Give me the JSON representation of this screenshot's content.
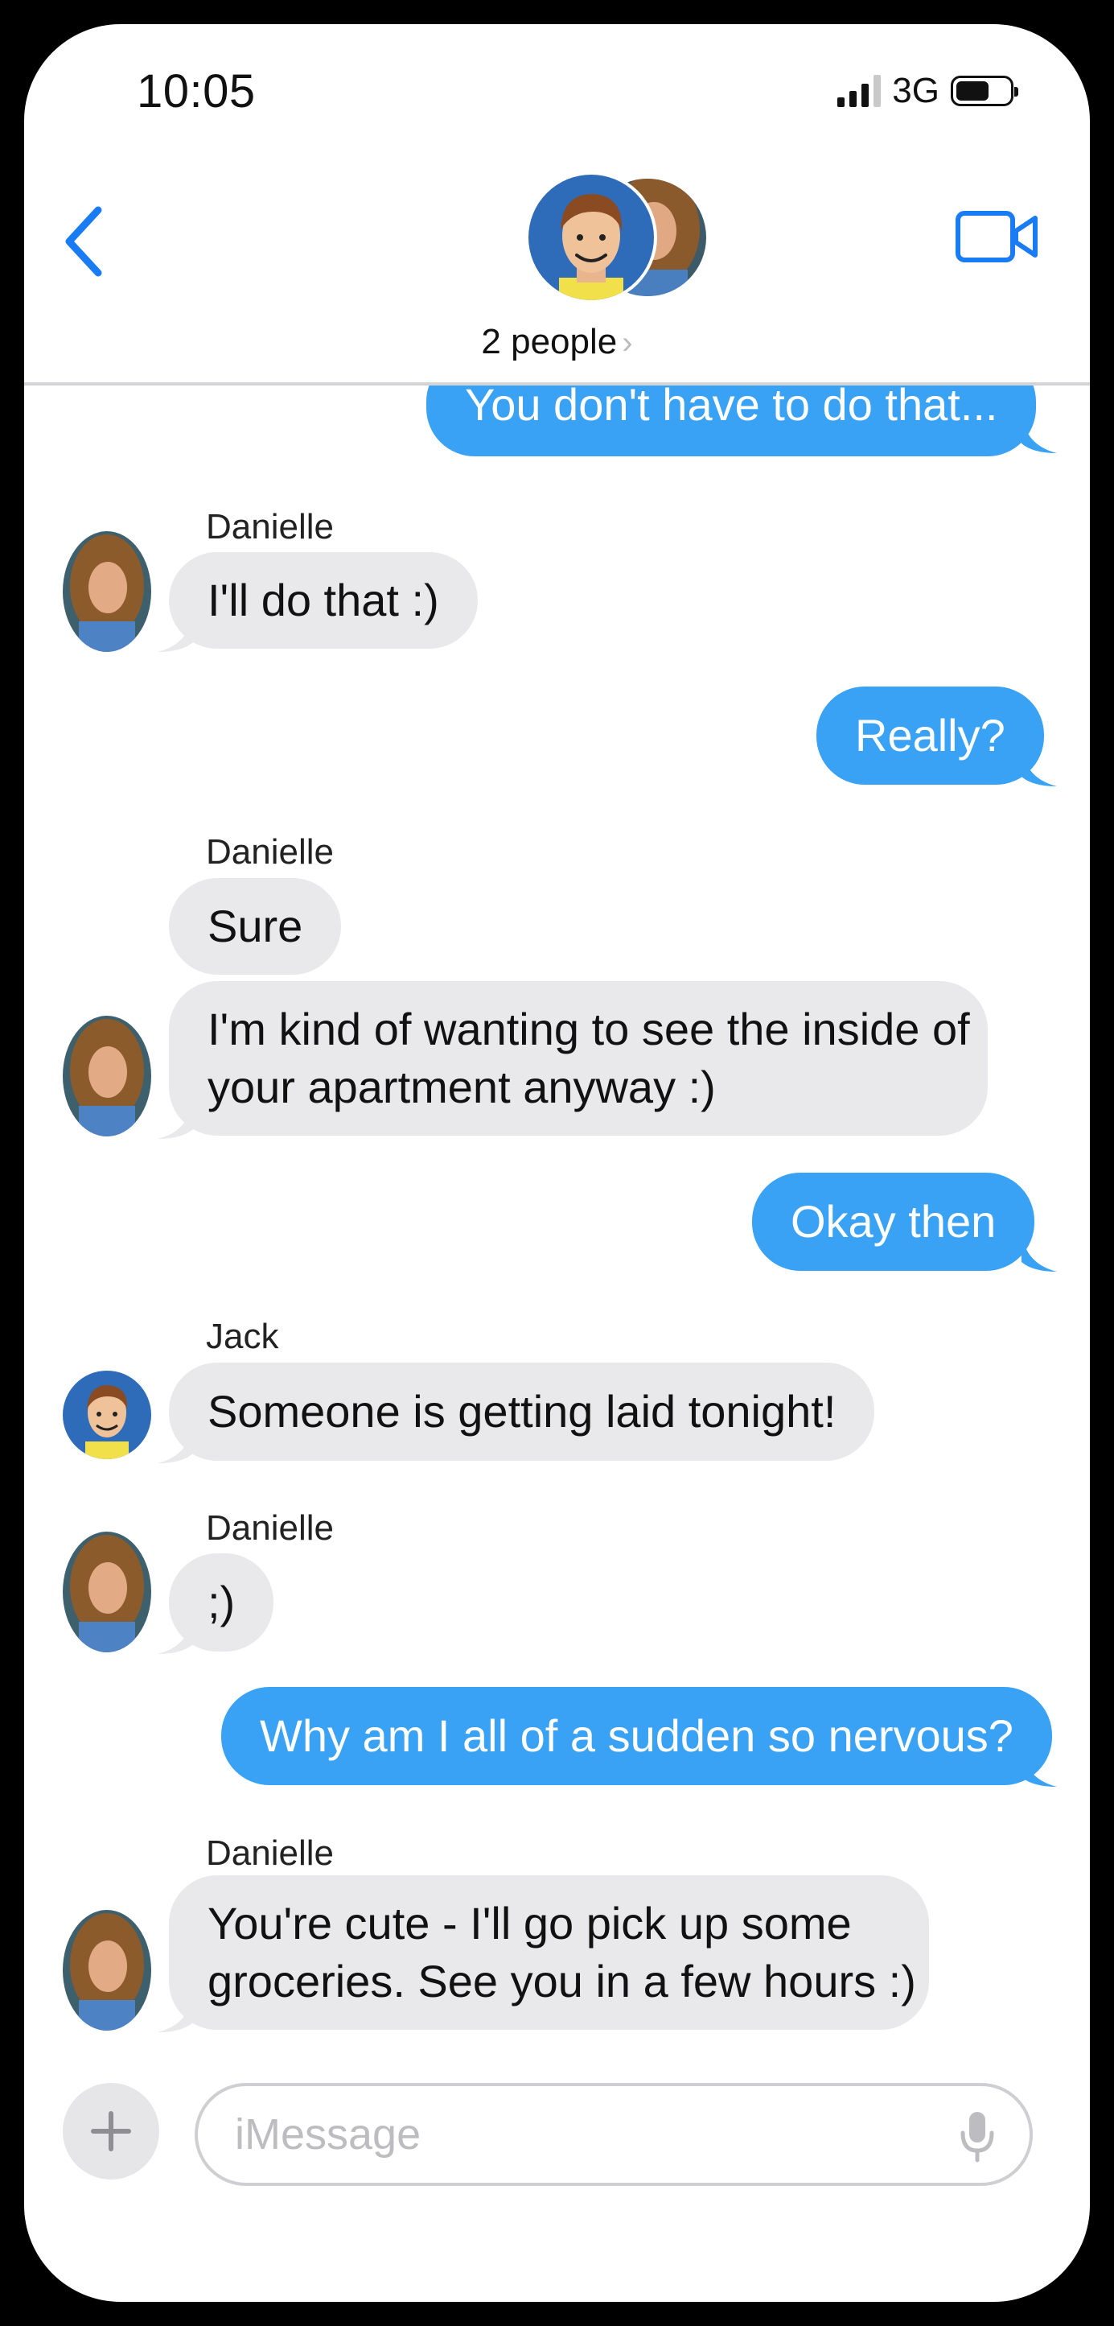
{
  "status_bar": {
    "time": "10:05",
    "network": "3G"
  },
  "header": {
    "people_label": "2 people",
    "people_chevron": "›"
  },
  "messages": [
    {
      "direction": "out",
      "text": "You don't have to do that..."
    },
    {
      "direction": "in",
      "sender": "Danielle",
      "text": "I'll do that :)"
    },
    {
      "direction": "out",
      "text": "Really?"
    },
    {
      "direction": "in",
      "sender": "Danielle",
      "text": "Sure"
    },
    {
      "direction": "in",
      "lines": [
        "I'm kind of wanting to see the inside of",
        "your apartment anyway :)"
      ]
    },
    {
      "direction": "out",
      "text": "Okay then"
    },
    {
      "direction": "in",
      "sender": "Jack",
      "text": "Someone is getting laid tonight!"
    },
    {
      "direction": "in",
      "sender": "Danielle",
      "text": ";)"
    },
    {
      "direction": "out",
      "text": "Why am I all of a sudden so nervous?"
    },
    {
      "direction": "in",
      "sender": "Danielle",
      "lines": [
        "You're cute - I'll go pick up some",
        "groceries.  See you in a few hours :)"
      ]
    }
  ],
  "input": {
    "placeholder": "iMessage"
  },
  "colors": {
    "outgoing_bubble": "#3aa2f5",
    "incoming_bubble": "#e9e9eb",
    "accent": "#1a7cf4"
  },
  "icons": [
    "back-chevron-icon",
    "video-camera-icon",
    "plus-icon",
    "microphone-icon"
  ]
}
